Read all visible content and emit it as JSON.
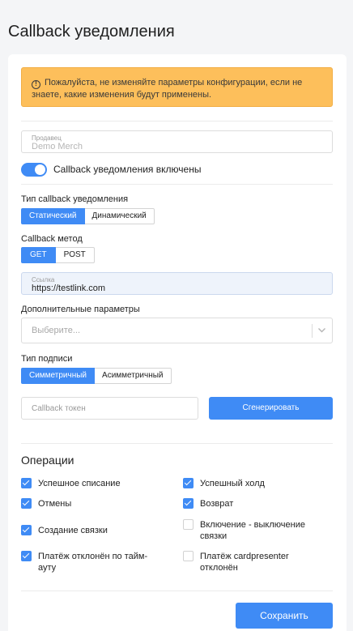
{
  "page": {
    "title": "Callback уведомления"
  },
  "alert": {
    "text": "Пожалуйста, не изменяйте параметры конфигурации, если не знаете, какие изменения будут применены."
  },
  "merchant": {
    "label": "Продавец",
    "value": "Demo Merch"
  },
  "toggle": {
    "label": "Callback уведомления включены",
    "enabled": true
  },
  "callback_type": {
    "label": "Тип callback уведомления",
    "options": [
      "Статический",
      "Динамический"
    ],
    "selected": "Статический"
  },
  "callback_method": {
    "label": "Callback метод",
    "options": [
      "GET",
      "POST"
    ],
    "selected": "GET"
  },
  "link": {
    "label": "Ссылка",
    "value": "https://testlink.com"
  },
  "extra_params": {
    "label": "Дополнительные параметры",
    "placeholder": "Выберите..."
  },
  "signature_type": {
    "label": "Тип подписи",
    "options": [
      "Симметричный",
      "Асимметричный"
    ],
    "selected": "Симметричный"
  },
  "token": {
    "placeholder": "Callback токен",
    "generate_label": "Сгенерировать"
  },
  "operations": {
    "title": "Операции",
    "items": [
      {
        "label": "Успешное списание",
        "checked": true
      },
      {
        "label": "Успешный холд",
        "checked": true
      },
      {
        "label": "Отмены",
        "checked": true
      },
      {
        "label": "Возврат",
        "checked": true
      },
      {
        "label": "Создание связки",
        "checked": true
      },
      {
        "label": "Включение - выключение связки",
        "checked": false
      },
      {
        "label": "Платёж отклонён по тайм-ауту",
        "checked": true
      },
      {
        "label": "Платёж cardpresenter отклонён",
        "checked": false
      }
    ]
  },
  "actions": {
    "save_label": "Сохранить"
  },
  "colors": {
    "accent": "#3f8bf5",
    "warning": "#fdbf5b"
  }
}
